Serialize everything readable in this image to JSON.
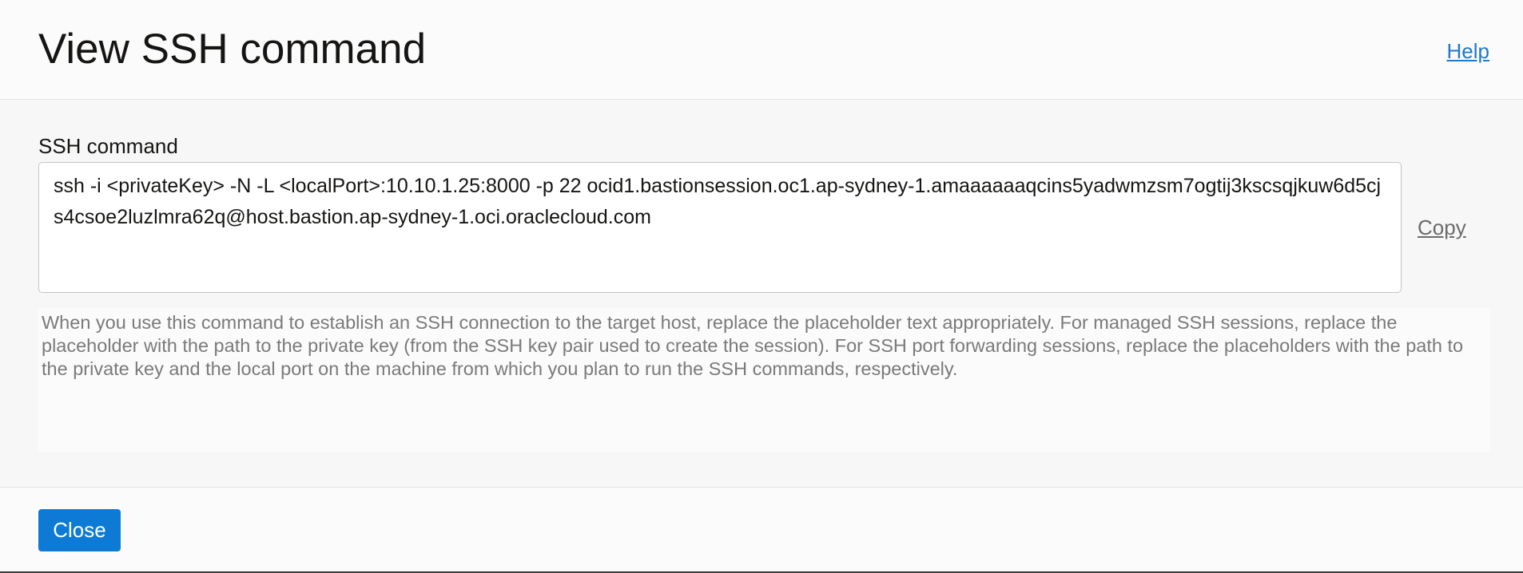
{
  "dialog": {
    "title": "View SSH command",
    "help_label": "Help"
  },
  "field": {
    "label": "SSH command",
    "value": "ssh -i <privateKey> -N -L <localPort>:10.10.1.25:8000 -p 22 ocid1.bastionsession.oc1.ap-sydney-1.amaaaaaaqcins5yadwmzsm7ogtij3kscsqjkuw6d5cjs4csoe2luzlmra62q@host.bastion.ap-sydney-1.oci.oraclecloud.com",
    "copy_label": "Copy"
  },
  "hint": {
    "text": "When you use this command to establish an SSH connection to the target host, replace the placeholder text appropriately. For managed SSH sessions, replace the placeholder with the path to the private key (from the SSH key pair used to create the session). For SSH port forwarding sessions, replace the placeholders with the path to the private key and the local port on the machine from which you plan to run the SSH commands, respectively."
  },
  "footer": {
    "close_label": "Close"
  },
  "colors": {
    "accent": "#0d7ad5",
    "link": "#1f7acb",
    "hint_text": "#7a7a7a"
  }
}
